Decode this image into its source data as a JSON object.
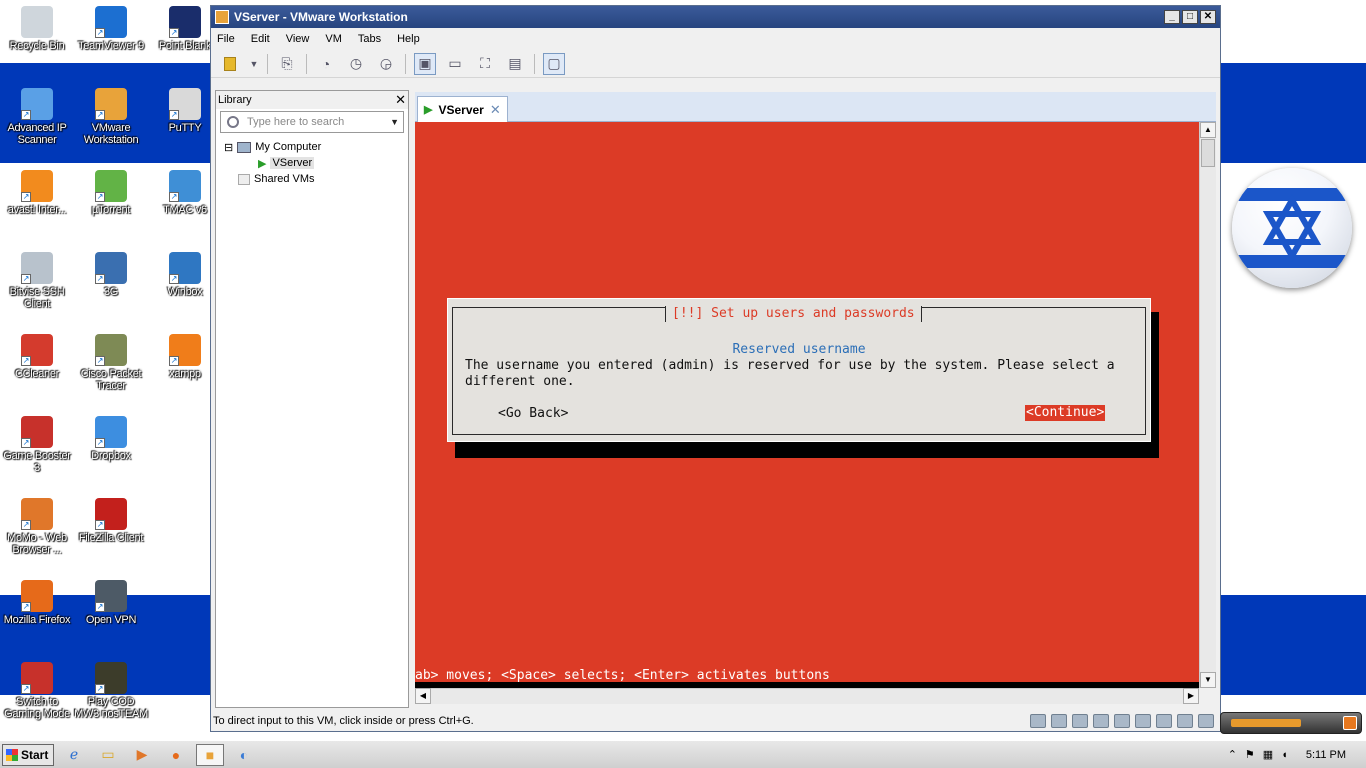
{
  "desktop": {
    "icons": [
      {
        "label": "Recycle Bin",
        "color": "#cfd6dc"
      },
      {
        "label": "TeamViewer 9",
        "color": "#1c6fd1"
      },
      {
        "label": "Point Blank",
        "color": "#1a2d6b"
      },
      {
        "label": "Advanced IP Scanner",
        "color": "#5aa0e6"
      },
      {
        "label": "VMware Workstation",
        "color": "#e8a33a"
      },
      {
        "label": "PuTTY",
        "color": "#d9d9d9"
      },
      {
        "label": "avast! Inter...",
        "color": "#f28b1e"
      },
      {
        "label": "µTorrent",
        "color": "#62b346"
      },
      {
        "label": "TMAC v6",
        "color": "#3f8fd6"
      },
      {
        "label": "Bitvise SSH Client",
        "color": "#b8c2cc"
      },
      {
        "label": "3G",
        "color": "#3a6fb0"
      },
      {
        "label": "Winbox",
        "color": "#2f77c2"
      },
      {
        "label": "CCleaner",
        "color": "#d43b2d"
      },
      {
        "label": "Cisco Packet Tracer",
        "color": "#7e8a55"
      },
      {
        "label": "xampp",
        "color": "#f07d1a"
      },
      {
        "label": "Game Booster 3",
        "color": "#c7312b"
      },
      {
        "label": "Dropbox",
        "color": "#3d8ee0"
      },
      {
        "label": "MoMo - Web Browser ...",
        "color": "#e0772a"
      },
      {
        "label": "FileZilla Client",
        "color": "#c3201c"
      },
      {
        "label": "Mozilla Firefox",
        "color": "#e66a1a"
      },
      {
        "label": "Open VPN",
        "color": "#4d5a66"
      },
      {
        "label": "Switch to Gaming Mode",
        "color": "#c7312b"
      },
      {
        "label": "Play COD MW3 nosTEAM",
        "color": "#3c3c2a"
      }
    ]
  },
  "window": {
    "title": "VServer - VMware Workstation",
    "controls": [
      "_",
      "□",
      "✕"
    ],
    "menu": [
      "File",
      "Edit",
      "View",
      "VM",
      "Tabs",
      "Help"
    ],
    "toolbar_icons": [
      "power-pause-icon",
      "dropdown-arrow-icon",
      "send-ctrl-alt-del-icon",
      "snapshot-take-icon",
      "snapshot-revert-icon",
      "snapshot-manager-icon",
      "view-console-icon",
      "view-quick-switch-icon",
      "view-full-screen-icon",
      "view-unity-icon",
      "view-thumbnail-icon"
    ]
  },
  "library": {
    "title": "Library",
    "close": "✕",
    "search_placeholder": "Type here to search",
    "tree": {
      "root": "My Computer",
      "vm": "VServer",
      "shared": "Shared VMs",
      "collapse": "⊟"
    }
  },
  "tab": {
    "label": "VServer",
    "close": "✕"
  },
  "installer": {
    "dialog_title": "[!!] Set up users and passwords",
    "subtitle": "Reserved username",
    "message": "The username you entered (admin) is reserved for use by the system. Please select a\ndifferent one.",
    "go_back": "<Go Back>",
    "continue": "<Continue>",
    "hint": "ab> moves; <Space> selects; <Enter> activates buttons",
    "colors": {
      "background": "#dc3b26",
      "dialog": "#e4e2de",
      "title": "#dc3b26",
      "subtitle": "#2c6fb7"
    }
  },
  "statusbar": {
    "text": "To direct input to this VM, click inside or press Ctrl+G."
  },
  "gauge": {
    "level_percent": 70
  },
  "taskbar": {
    "start": "Start",
    "time": "5:11 PM",
    "tray_icons": [
      "show-hidden-icon",
      "action-center-flag-icon",
      "network-icon",
      "volume-icon"
    ]
  }
}
